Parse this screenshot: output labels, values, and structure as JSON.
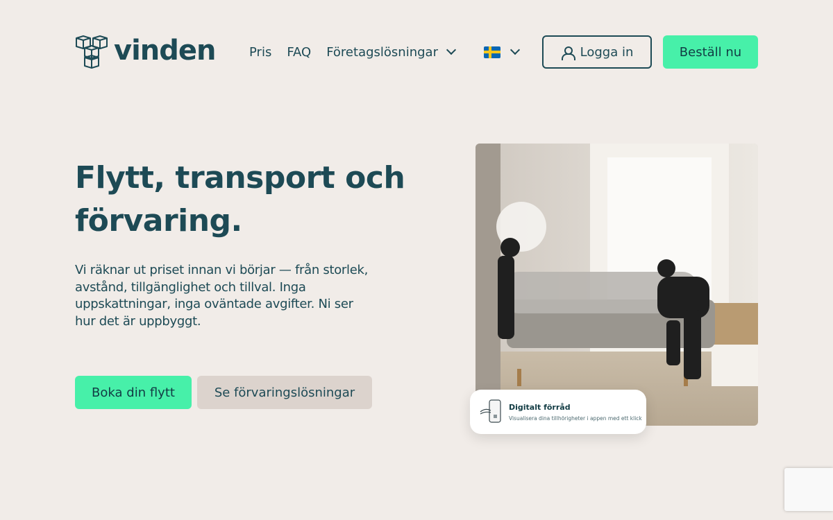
{
  "brand": {
    "name": "vinden"
  },
  "nav": {
    "items": [
      {
        "label": "Pris"
      },
      {
        "label": "FAQ"
      },
      {
        "label": "Företagslösningar"
      }
    ],
    "language_icon": "swedish-flag-icon"
  },
  "header": {
    "login_label": "Logga in",
    "order_label": "Beställ nu"
  },
  "hero": {
    "title": "Flytt, transport och förvaring.",
    "description": "Vi räknar ut priset innan vi börjar — från storlek, avstånd, tillgänglighet och tillval. Inga uppskattningar, inga oväntade avgifter. Ni ser hur det är uppbyggt.",
    "primary_cta": "Boka din flytt",
    "secondary_cta": "Se förvaringslösningar"
  },
  "storage_card": {
    "title": "Digitalt förråd",
    "subtitle": "Visualisera dina tillhörigheter i appen med ett klick"
  },
  "colors": {
    "background": "#f1ece8",
    "primary_text": "#1d4a55",
    "accent": "#47f0a9",
    "secondary_button": "#dcd3cd"
  }
}
